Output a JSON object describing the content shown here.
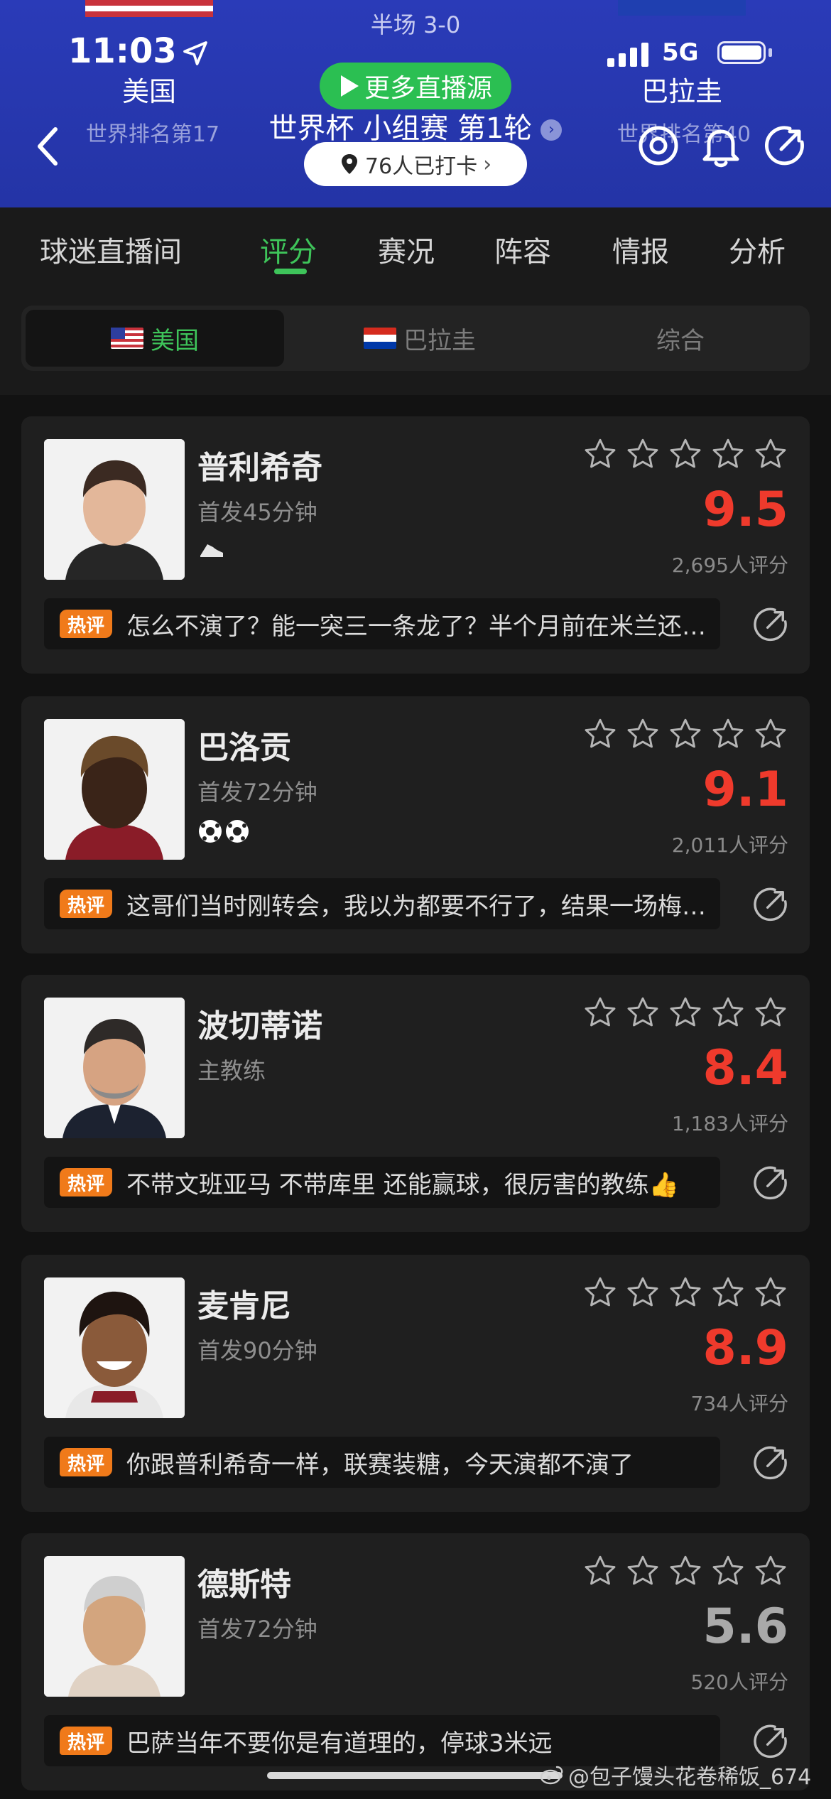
{
  "status": {
    "time": "11:03",
    "network": "5G"
  },
  "match": {
    "halftime": "半场 3-0",
    "home": {
      "name": "美国",
      "rank": "世界排名第17"
    },
    "away": {
      "name": "巴拉圭",
      "rank": "世界排名第40"
    },
    "title": "世界杯 小组赛 第1轮",
    "more_sources": "更多直播源",
    "checkin": "76人已打卡"
  },
  "tabs": [
    "球迷直播间",
    "评分",
    "赛况",
    "阵容",
    "情报",
    "分析"
  ],
  "active_tab": "评分",
  "segments": [
    "美国",
    "巴拉圭",
    "综合"
  ],
  "active_segment": "美国",
  "hot_tag": "热评",
  "players": [
    {
      "name": "普利希奇",
      "role": "首发45分钟",
      "score": "9.5",
      "votes": "2,695人评分",
      "badge": "boot-icon",
      "comment": "怎么不演了？能一突三一条龙了？半个月前在米兰还被人喷",
      "score_color": "#ef3a2c"
    },
    {
      "name": "巴洛贡",
      "role": "首发72分钟",
      "score": "9.1",
      "votes": "2,011人评分",
      "badge": "two-goals-icon",
      "comment": "这哥们当时刚转会，我以为都要不行了，结果一场梅开二度",
      "score_color": "#ef3a2c"
    },
    {
      "name": "波切蒂诺",
      "role": "主教练",
      "score": "8.4",
      "votes": "1,183人评分",
      "badge": "",
      "comment": "不带文班亚马 不带库里 还能赢球，很厉害的教练👍",
      "score_color": "#ef3a2c"
    },
    {
      "name": "麦肯尼",
      "role": "首发90分钟",
      "score": "8.9",
      "votes": "734人评分",
      "badge": "",
      "comment": "你跟普利希奇一样，联赛装糖，今天演都不演了",
      "score_color": "#ef3a2c"
    },
    {
      "name": "德斯特",
      "role": "首发72分钟",
      "score": "5.6",
      "votes": "520人评分",
      "badge": "",
      "comment": "巴萨当年不要你是有道理的，停球3米远",
      "score_color": "#a9a9a9"
    }
  ],
  "watermark": "@包子馒头花卷稀饭_674",
  "colors": {
    "header_bg": "#2434a6",
    "accent_green": "#3ec45a",
    "score_red": "#ef3a2c",
    "hot_orange": "#f07a1a",
    "page_bg": "#121212"
  }
}
